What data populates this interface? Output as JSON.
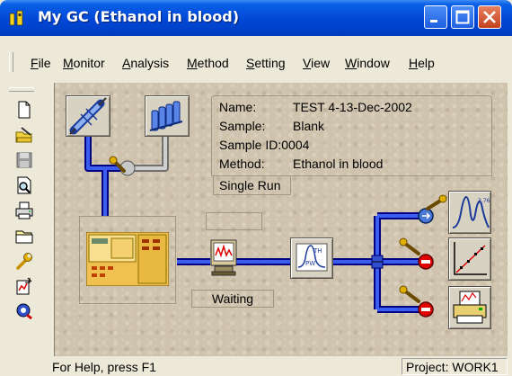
{
  "window": {
    "title": "My GC (Ethanol in blood)"
  },
  "menu": [
    {
      "label": "File",
      "key": "F",
      "rest": "ile"
    },
    {
      "label": "Monitor",
      "key": "M",
      "rest": "onitor"
    },
    {
      "label": "Analysis",
      "key": "A",
      "rest": "nalysis"
    },
    {
      "label": "Method",
      "key": "M",
      "rest": "ethod"
    },
    {
      "label": "Setting",
      "key": "S",
      "rest": "etting"
    },
    {
      "label": "View",
      "key": "V",
      "rest": "iew"
    },
    {
      "label": "Window",
      "key": "W",
      "rest": "indow"
    },
    {
      "label": "Help",
      "key": "H",
      "rest": "elp"
    }
  ],
  "toolbar": {
    "icons": [
      "new-file-icon",
      "open-method-icon",
      "save-icon",
      "preview-icon",
      "print-icon",
      "open-folder-icon",
      "wrench-icon",
      "report-icon",
      "search-icon"
    ]
  },
  "info": {
    "name_label": "Name:",
    "name_value": "TEST 4-13-Dec-2002",
    "sample_label": "Sample:",
    "sample_value": "Blank",
    "sample_id_label": "Sample ID:",
    "sample_id_value": "0004",
    "method_label": "Method:",
    "method_value": "Ethanol in blood",
    "run_tab": "Single Run"
  },
  "instrument": {
    "status": "Waiting"
  },
  "flow_icons": [
    "autosampler-icon",
    "sample-rack-icon",
    "gc-instrument-icon",
    "monitor-icon",
    "chromatogram-processing-icon",
    "peaks-output-icon",
    "calibration-output-icon",
    "printer-output-icon"
  ],
  "statusbar": {
    "help": "For Help, press F1",
    "project": "Project: WORK1"
  },
  "colors": {
    "titlebar": "#0047d6",
    "pipe_blue": "#0000cc",
    "pipe_gray": "#a6a6a6",
    "valve_red": "#e00000",
    "valve_blue": "#4a78d6"
  }
}
